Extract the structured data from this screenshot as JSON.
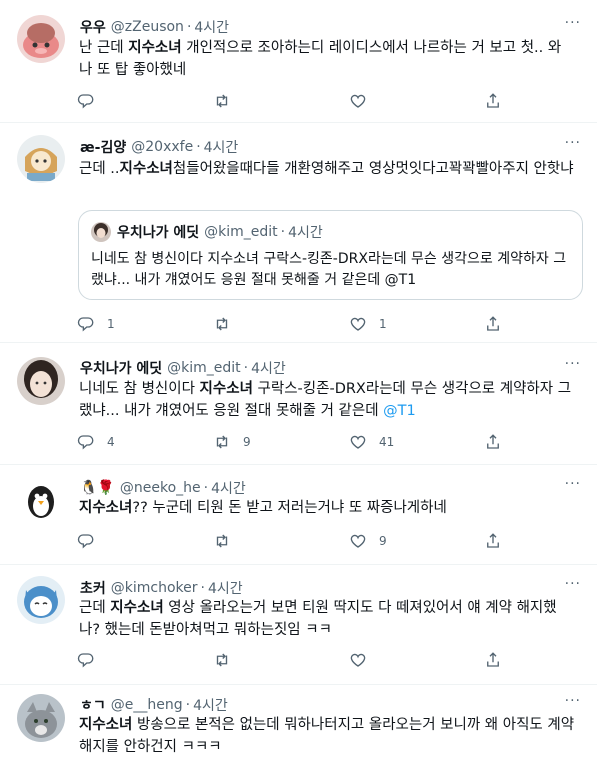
{
  "tweets": [
    {
      "name": "우우",
      "handle": "@zZeuson",
      "time": "4시간",
      "more": "···",
      "body_pre": "난 근데 ",
      "body_bold": "지수소녀",
      "body_post": " 개인적으로 조아하는디 레이디스에서 나르하는 거 보고 첫.. 와 나 또 탑 좋아했네",
      "reply_count": "",
      "retweet_count": "",
      "like_count": ""
    },
    {
      "name": "æ-김양",
      "handle": "@20xxfe",
      "time": "4시간",
      "more": "···",
      "body_pre": "근데 ..",
      "body_bold": "지수소녀",
      "body_post": "첨들어왔을때다들 개환영해주고 영상멋잇다고꽉꽉빨아주지 안핫냐",
      "quote": {
        "name": "우치나가 에딧",
        "handle": "@kim_edit",
        "time": "4시간",
        "body": "니네도 참 병신이다 지수소녀 구락스-킹존-DRX라는데 무슨 생각으로 계약하자 그랬냐... 내가 걔였어도 응원 절대 못해줄 거 같은데 @T1"
      },
      "reply_count": "1",
      "retweet_count": "",
      "like_count": "1"
    },
    {
      "name": "우치나가 에딧",
      "handle": "@kim_edit",
      "time": "4시간",
      "more": "···",
      "body_pre": "니네도 참 병신이다 ",
      "body_bold": "지수소녀",
      "body_post": " 구락스-킹존-DRX라는데 무슨 생각으로 계약하자 그랬냐... 내가 걔였어도 응원 절대 못해줄 거 같은데 ",
      "mention": "@T1",
      "reply_count": "4",
      "retweet_count": "9",
      "like_count": "41"
    },
    {
      "name": "🐧🌹",
      "handle": "@neeko_he",
      "time": "4시간",
      "more": "···",
      "body_pre": "",
      "body_bold": "지수소녀",
      "body_post": "?? 누군데 티원 돈 받고 저러는거냐 또 짜증나게하네",
      "reply_count": "",
      "retweet_count": "",
      "like_count": "9"
    },
    {
      "name": "초커",
      "handle": "@kimchoker",
      "time": "4시간",
      "more": "···",
      "body_pre": "근데 ",
      "body_bold": "지수소녀",
      "body_post": " 영상 올라오는거 보면 티원 딱지도 다 떼져있어서 얘 계약 해지했나? 했는데 돈받아쳐먹고 뭐하는짓임 ㅋㅋ",
      "reply_count": "",
      "retweet_count": "",
      "like_count": ""
    },
    {
      "name": "ㅎㄱ",
      "handle": "@e__heng",
      "time": "4시간",
      "more": "···",
      "body_pre": "",
      "body_bold": "지수소녀",
      "body_post": " 방송으로 본적은 없는데 뭐하나터지고 올라오는거 보니까 왜 아직도 계약해지를 안하건지 ㅋㅋㅋ"
    }
  ],
  "icons": {
    "reply": "reply-icon",
    "retweet": "retweet-icon",
    "like": "like-icon",
    "share": "share-icon",
    "more": "more-icon"
  }
}
